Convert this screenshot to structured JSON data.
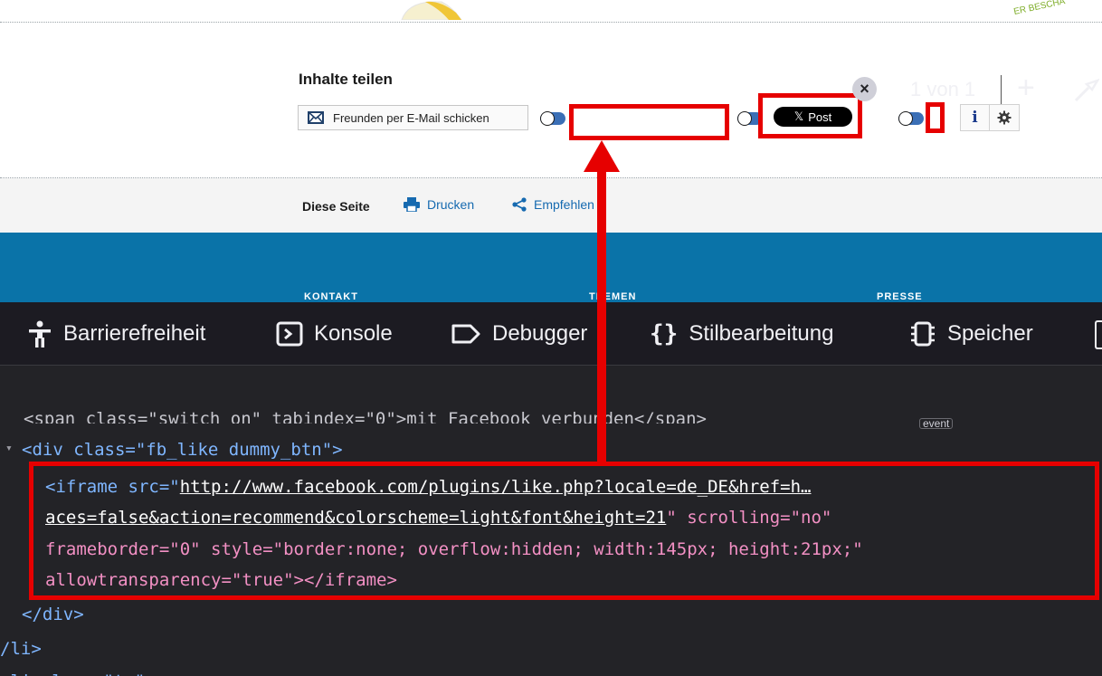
{
  "webpage": {
    "corner_text": "ER BESCHA",
    "share_title": "Inhalte teilen",
    "mail_button": "Freunden per E-Mail schicken",
    "x_post_label": "Post",
    "x_glyph": "𝕏",
    "info_label": "i",
    "page_label": "Diese Seite",
    "print_label": "Drucken",
    "share_label": "Empfehlen",
    "footer_headings": [
      "KONTAKT",
      "THEMEN",
      "PRESSE"
    ]
  },
  "devtools": {
    "tabs": [
      {
        "label": "Barrierefreiheit",
        "icon": "accessibility-icon"
      },
      {
        "label": "Konsole",
        "icon": "console-icon"
      },
      {
        "label": "Debugger",
        "icon": "debugger-icon"
      },
      {
        "label": "Stilbearbeitung",
        "icon": "style-editor-icon"
      },
      {
        "label": "Speicher",
        "icon": "memory-icon"
      }
    ],
    "search_close": "×",
    "match_count": "1 von 1",
    "add_label": "+",
    "partial_line": "<span class=\"switch on\" tabindex=\"0\">mit Facebook verbunden</span>",
    "event_badge": "event",
    "div_open": "<div class=\"fb_like dummy_btn\">",
    "iframe_line1_prefix": "<iframe src=\"",
    "iframe_line1_url": "http://www.facebook.com/plugins/like.php?locale=de_DE&href=h…",
    "iframe_line2_url": "aces=false&action=recommend&colorscheme=light&font&height=21",
    "iframe_line2_suffix": "\" scrolling=\"no\"",
    "iframe_line3": "frameborder=\"0\" style=\"border:none; overflow:hidden; width:145px; height:21px;\"",
    "iframe_line4": "allowtransparency=\"true\"></iframe>",
    "div_close": "</div>",
    "li_close": "/li>",
    "colors": {
      "accent_red": "#e60000",
      "tag_blue": "#7fb6ff",
      "attr_pink": "#f390c4"
    }
  }
}
